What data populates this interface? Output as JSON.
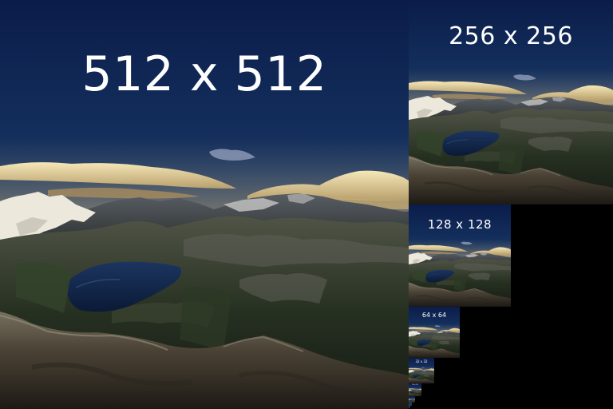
{
  "texture": {
    "levels": [
      {
        "id": "mip-512",
        "label": "512 x 512"
      },
      {
        "id": "mip-256",
        "label": "256 x 256"
      },
      {
        "id": "mip-128",
        "label": "128 x 128"
      },
      {
        "id": "mip-64",
        "label": "64 x 64"
      },
      {
        "id": "mip-32",
        "label": "32 x 32"
      },
      {
        "id": "mip-16",
        "label": "16 x 16"
      }
    ]
  },
  "colors": {
    "sky_top": "#0b1c4a",
    "sky_mid": "#1d3c6e",
    "sky_horizon": "#3d5f86",
    "cloud": "#e9d6a0",
    "snow": "#f1efe6",
    "mountain": "#2c2f2c",
    "lake": "#0e2242",
    "foreground": "#4c4338",
    "background": "#000000"
  }
}
